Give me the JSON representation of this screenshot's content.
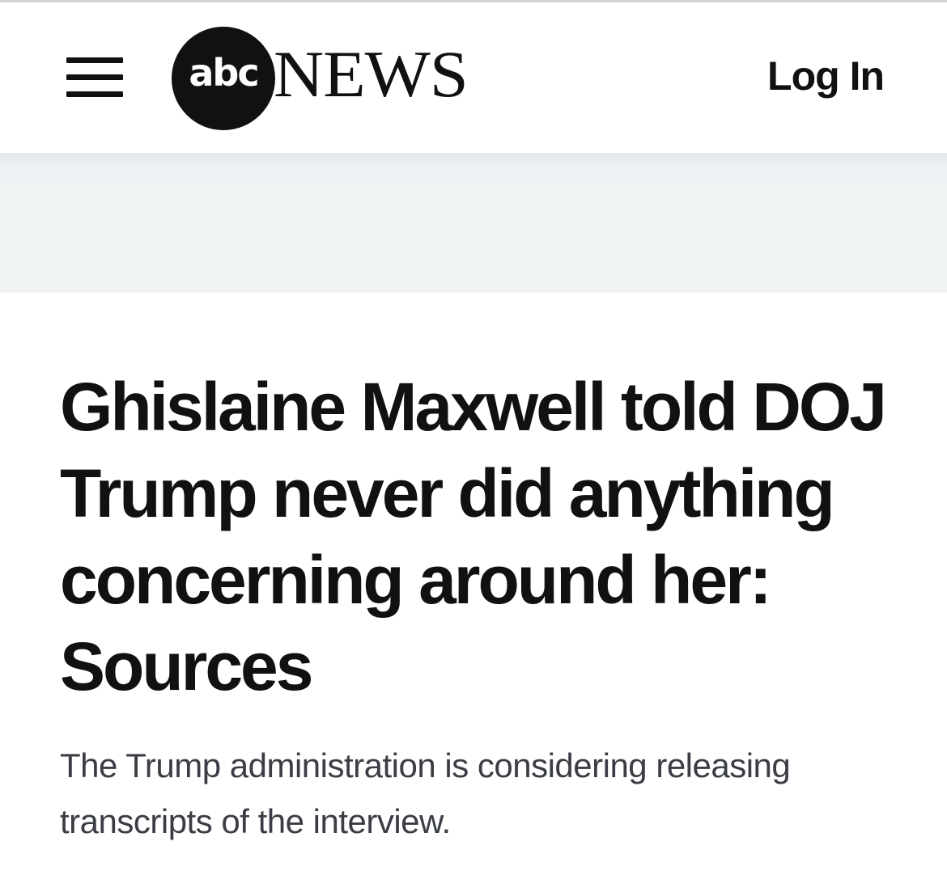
{
  "header": {
    "menu_icon": "hamburger-menu-icon",
    "logo": {
      "abc_text": "abc",
      "news_text": "NEWS"
    },
    "login_label": "Log In"
  },
  "article": {
    "headline": "Ghislaine Maxwell told DOJ Trump never did anything concerning around her: Sources",
    "subheadline": "The Trump administration is considering releasing transcripts of the interview."
  },
  "colors": {
    "text": "#111111",
    "subtext": "#3a3e44",
    "ad_band": "#f1f4f5"
  }
}
